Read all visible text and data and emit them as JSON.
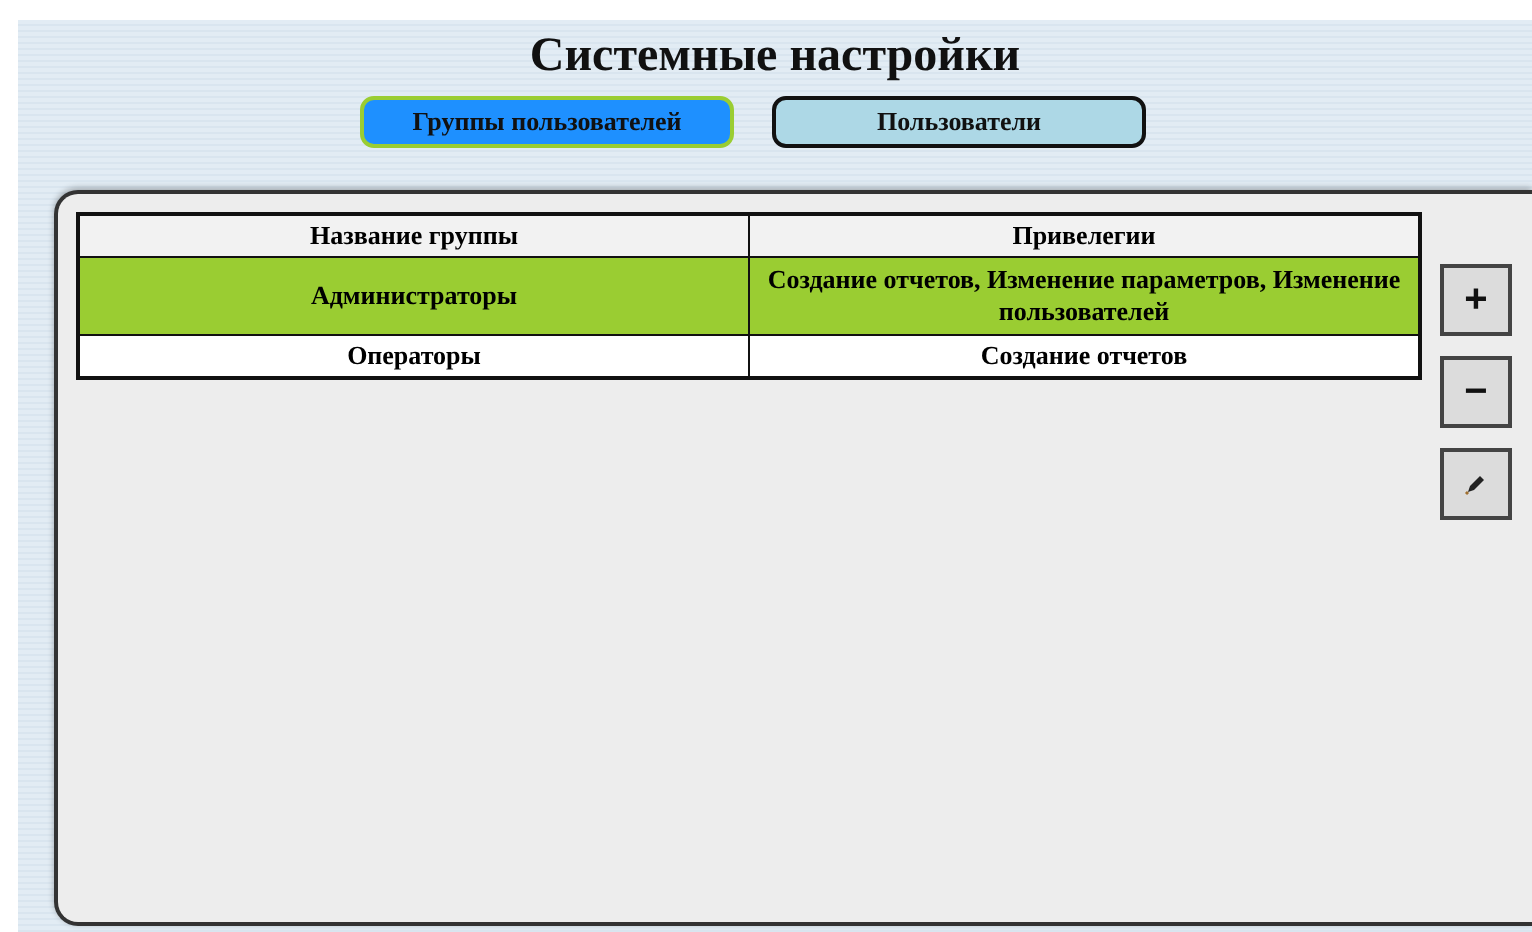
{
  "title": "Системные настройки",
  "tabs": [
    {
      "label": "Группы пользователей",
      "selected": true
    },
    {
      "label": "Пользователи",
      "selected": false
    }
  ],
  "table": {
    "columns": [
      "Название группы",
      "Привелегии"
    ],
    "rows": [
      {
        "cells": [
          "Администраторы",
          "Создание отчетов, Изменение параметров, Изменение пользователей"
        ],
        "selected": true
      },
      {
        "cells": [
          "Операторы",
          "Создание отчетов"
        ],
        "selected": false
      }
    ]
  },
  "actions": [
    {
      "kind": "text",
      "label": "+"
    },
    {
      "kind": "text",
      "label": "−"
    },
    {
      "kind": "edit"
    }
  ]
}
